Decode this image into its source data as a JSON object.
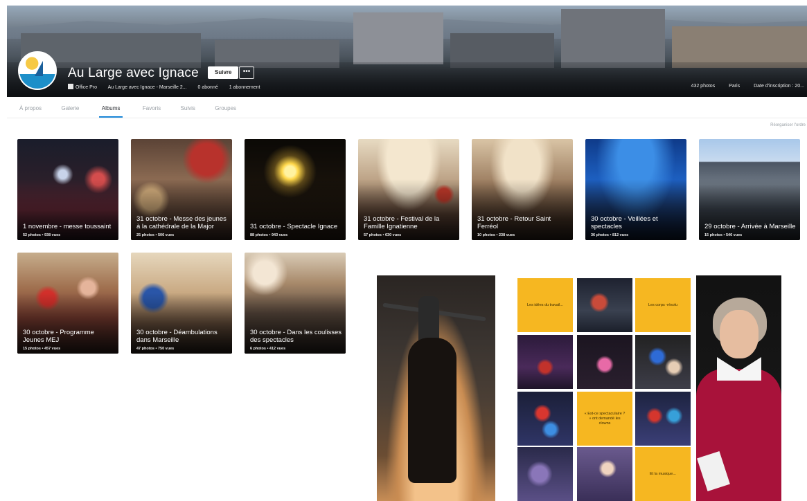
{
  "header": {
    "account_name": "Au Large avec Ignace",
    "follow_label": "Suivre",
    "more_label": "•••",
    "meta": {
      "pro_label": "Office Pro",
      "location": "Au Large avec Ignace - Marseille 2...",
      "followers": "0 abonné",
      "following": "1 abonnement"
    },
    "meta_right": {
      "photos": "432 photos",
      "city": "Paris",
      "joined": "Date d'inscription : 20..."
    }
  },
  "tabs": [
    {
      "label": "À propos",
      "active": false
    },
    {
      "label": "Galerie",
      "active": false
    },
    {
      "label": "Albums",
      "active": true
    },
    {
      "label": "Favoris",
      "active": false
    },
    {
      "label": "Suivis",
      "active": false
    },
    {
      "label": "Groupes",
      "active": false
    }
  ],
  "sort_link": "Réorganiser l'ordre",
  "albums": [
    {
      "title": "1 novembre - messe toussaint",
      "stats": "52 photos • 938 vues"
    },
    {
      "title": "31 octobre - Messe des jeunes à la cathédrale de la Major",
      "stats": "25 photos • 506 vues"
    },
    {
      "title": "31 octobre - Spectacle Ignace",
      "stats": "88 photos • 943 vues"
    },
    {
      "title": "31 octobre - Festival de la Famille Ignatienne",
      "stats": "57 photos • 630 vues"
    },
    {
      "title": "31 octobre - Retour Saint Ferréol",
      "stats": "10 photos • 238 vues"
    },
    {
      "title": "30 octobre - Veillées et spectacles",
      "stats": "36 photos • 812 vues"
    },
    {
      "title": "29 octobre - Arrivée à Marseille",
      "stats": "15 photos • 546 vues"
    },
    {
      "title": "30 octobre - Programme Jeunes MEJ",
      "stats": "15 photos • 457 vues"
    },
    {
      "title": "30 octobre - Déambulations dans Marseille",
      "stats": "47 photos • 750 vues"
    },
    {
      "title": "30 octobre - Dans les coulisses des spectacles",
      "stats": "6 photos • 412 vues"
    }
  ],
  "collage": {
    "yellow_texts": [
      "Les idées du travail...",
      "Les corps -résolu",
      "« Est-ce spectaculaire ? » ont demandé les clowns",
      "Et la musique..."
    ]
  },
  "colors": {
    "accent": "#1a87d8",
    "yellow": "#f6b721",
    "sweater": "#a8123a"
  }
}
